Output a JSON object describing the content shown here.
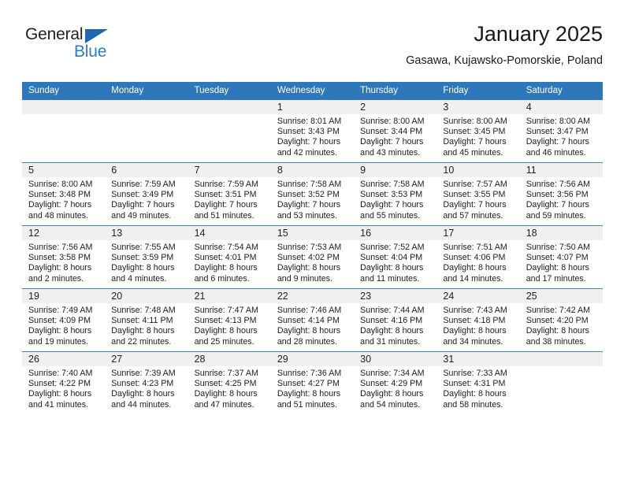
{
  "logo": {
    "line1": "General",
    "line2": "Blue",
    "triangle_color": "#1f68b0",
    "line2_color": "#2b7cc4"
  },
  "header": {
    "month_title": "January 2025",
    "location": "Gasawa, Kujawsko-Pomorskie, Poland"
  },
  "theme": {
    "header_background": "#2e77ba",
    "header_text": "#ffffff",
    "daynum_band": "#f0f0f0",
    "row_divider": "#3f81bf"
  },
  "weekday_headers": [
    "Sunday",
    "Monday",
    "Tuesday",
    "Wednesday",
    "Thursday",
    "Friday",
    "Saturday"
  ],
  "weeks": [
    [
      {
        "day": "",
        "blank": true,
        "sunrise": "",
        "sunset": "",
        "daylight_line1": "",
        "daylight_line2": ""
      },
      {
        "day": "",
        "blank": true,
        "sunrise": "",
        "sunset": "",
        "daylight_line1": "",
        "daylight_line2": ""
      },
      {
        "day": "",
        "blank": true,
        "sunrise": "",
        "sunset": "",
        "daylight_line1": "",
        "daylight_line2": ""
      },
      {
        "day": "1",
        "blank": false,
        "sunrise": "Sunrise: 8:01 AM",
        "sunset": "Sunset: 3:43 PM",
        "daylight_line1": "Daylight: 7 hours",
        "daylight_line2": "and 42 minutes."
      },
      {
        "day": "2",
        "blank": false,
        "sunrise": "Sunrise: 8:00 AM",
        "sunset": "Sunset: 3:44 PM",
        "daylight_line1": "Daylight: 7 hours",
        "daylight_line2": "and 43 minutes."
      },
      {
        "day": "3",
        "blank": false,
        "sunrise": "Sunrise: 8:00 AM",
        "sunset": "Sunset: 3:45 PM",
        "daylight_line1": "Daylight: 7 hours",
        "daylight_line2": "and 45 minutes."
      },
      {
        "day": "4",
        "blank": false,
        "sunrise": "Sunrise: 8:00 AM",
        "sunset": "Sunset: 3:47 PM",
        "daylight_line1": "Daylight: 7 hours",
        "daylight_line2": "and 46 minutes."
      }
    ],
    [
      {
        "day": "5",
        "blank": false,
        "sunrise": "Sunrise: 8:00 AM",
        "sunset": "Sunset: 3:48 PM",
        "daylight_line1": "Daylight: 7 hours",
        "daylight_line2": "and 48 minutes."
      },
      {
        "day": "6",
        "blank": false,
        "sunrise": "Sunrise: 7:59 AM",
        "sunset": "Sunset: 3:49 PM",
        "daylight_line1": "Daylight: 7 hours",
        "daylight_line2": "and 49 minutes."
      },
      {
        "day": "7",
        "blank": false,
        "sunrise": "Sunrise: 7:59 AM",
        "sunset": "Sunset: 3:51 PM",
        "daylight_line1": "Daylight: 7 hours",
        "daylight_line2": "and 51 minutes."
      },
      {
        "day": "8",
        "blank": false,
        "sunrise": "Sunrise: 7:58 AM",
        "sunset": "Sunset: 3:52 PM",
        "daylight_line1": "Daylight: 7 hours",
        "daylight_line2": "and 53 minutes."
      },
      {
        "day": "9",
        "blank": false,
        "sunrise": "Sunrise: 7:58 AM",
        "sunset": "Sunset: 3:53 PM",
        "daylight_line1": "Daylight: 7 hours",
        "daylight_line2": "and 55 minutes."
      },
      {
        "day": "10",
        "blank": false,
        "sunrise": "Sunrise: 7:57 AM",
        "sunset": "Sunset: 3:55 PM",
        "daylight_line1": "Daylight: 7 hours",
        "daylight_line2": "and 57 minutes."
      },
      {
        "day": "11",
        "blank": false,
        "sunrise": "Sunrise: 7:56 AM",
        "sunset": "Sunset: 3:56 PM",
        "daylight_line1": "Daylight: 7 hours",
        "daylight_line2": "and 59 minutes."
      }
    ],
    [
      {
        "day": "12",
        "blank": false,
        "sunrise": "Sunrise: 7:56 AM",
        "sunset": "Sunset: 3:58 PM",
        "daylight_line1": "Daylight: 8 hours",
        "daylight_line2": "and 2 minutes."
      },
      {
        "day": "13",
        "blank": false,
        "sunrise": "Sunrise: 7:55 AM",
        "sunset": "Sunset: 3:59 PM",
        "daylight_line1": "Daylight: 8 hours",
        "daylight_line2": "and 4 minutes."
      },
      {
        "day": "14",
        "blank": false,
        "sunrise": "Sunrise: 7:54 AM",
        "sunset": "Sunset: 4:01 PM",
        "daylight_line1": "Daylight: 8 hours",
        "daylight_line2": "and 6 minutes."
      },
      {
        "day": "15",
        "blank": false,
        "sunrise": "Sunrise: 7:53 AM",
        "sunset": "Sunset: 4:02 PM",
        "daylight_line1": "Daylight: 8 hours",
        "daylight_line2": "and 9 minutes."
      },
      {
        "day": "16",
        "blank": false,
        "sunrise": "Sunrise: 7:52 AM",
        "sunset": "Sunset: 4:04 PM",
        "daylight_line1": "Daylight: 8 hours",
        "daylight_line2": "and 11 minutes."
      },
      {
        "day": "17",
        "blank": false,
        "sunrise": "Sunrise: 7:51 AM",
        "sunset": "Sunset: 4:06 PM",
        "daylight_line1": "Daylight: 8 hours",
        "daylight_line2": "and 14 minutes."
      },
      {
        "day": "18",
        "blank": false,
        "sunrise": "Sunrise: 7:50 AM",
        "sunset": "Sunset: 4:07 PM",
        "daylight_line1": "Daylight: 8 hours",
        "daylight_line2": "and 17 minutes."
      }
    ],
    [
      {
        "day": "19",
        "blank": false,
        "sunrise": "Sunrise: 7:49 AM",
        "sunset": "Sunset: 4:09 PM",
        "daylight_line1": "Daylight: 8 hours",
        "daylight_line2": "and 19 minutes."
      },
      {
        "day": "20",
        "blank": false,
        "sunrise": "Sunrise: 7:48 AM",
        "sunset": "Sunset: 4:11 PM",
        "daylight_line1": "Daylight: 8 hours",
        "daylight_line2": "and 22 minutes."
      },
      {
        "day": "21",
        "blank": false,
        "sunrise": "Sunrise: 7:47 AM",
        "sunset": "Sunset: 4:13 PM",
        "daylight_line1": "Daylight: 8 hours",
        "daylight_line2": "and 25 minutes."
      },
      {
        "day": "22",
        "blank": false,
        "sunrise": "Sunrise: 7:46 AM",
        "sunset": "Sunset: 4:14 PM",
        "daylight_line1": "Daylight: 8 hours",
        "daylight_line2": "and 28 minutes."
      },
      {
        "day": "23",
        "blank": false,
        "sunrise": "Sunrise: 7:44 AM",
        "sunset": "Sunset: 4:16 PM",
        "daylight_line1": "Daylight: 8 hours",
        "daylight_line2": "and 31 minutes."
      },
      {
        "day": "24",
        "blank": false,
        "sunrise": "Sunrise: 7:43 AM",
        "sunset": "Sunset: 4:18 PM",
        "daylight_line1": "Daylight: 8 hours",
        "daylight_line2": "and 34 minutes."
      },
      {
        "day": "25",
        "blank": false,
        "sunrise": "Sunrise: 7:42 AM",
        "sunset": "Sunset: 4:20 PM",
        "daylight_line1": "Daylight: 8 hours",
        "daylight_line2": "and 38 minutes."
      }
    ],
    [
      {
        "day": "26",
        "blank": false,
        "sunrise": "Sunrise: 7:40 AM",
        "sunset": "Sunset: 4:22 PM",
        "daylight_line1": "Daylight: 8 hours",
        "daylight_line2": "and 41 minutes."
      },
      {
        "day": "27",
        "blank": false,
        "sunrise": "Sunrise: 7:39 AM",
        "sunset": "Sunset: 4:23 PM",
        "daylight_line1": "Daylight: 8 hours",
        "daylight_line2": "and 44 minutes."
      },
      {
        "day": "28",
        "blank": false,
        "sunrise": "Sunrise: 7:37 AM",
        "sunset": "Sunset: 4:25 PM",
        "daylight_line1": "Daylight: 8 hours",
        "daylight_line2": "and 47 minutes."
      },
      {
        "day": "29",
        "blank": false,
        "sunrise": "Sunrise: 7:36 AM",
        "sunset": "Sunset: 4:27 PM",
        "daylight_line1": "Daylight: 8 hours",
        "daylight_line2": "and 51 minutes."
      },
      {
        "day": "30",
        "blank": false,
        "sunrise": "Sunrise: 7:34 AM",
        "sunset": "Sunset: 4:29 PM",
        "daylight_line1": "Daylight: 8 hours",
        "daylight_line2": "and 54 minutes."
      },
      {
        "day": "31",
        "blank": false,
        "sunrise": "Sunrise: 7:33 AM",
        "sunset": "Sunset: 4:31 PM",
        "daylight_line1": "Daylight: 8 hours",
        "daylight_line2": "and 58 minutes."
      },
      {
        "day": "",
        "blank": true,
        "sunrise": "",
        "sunset": "",
        "daylight_line1": "",
        "daylight_line2": ""
      }
    ]
  ]
}
